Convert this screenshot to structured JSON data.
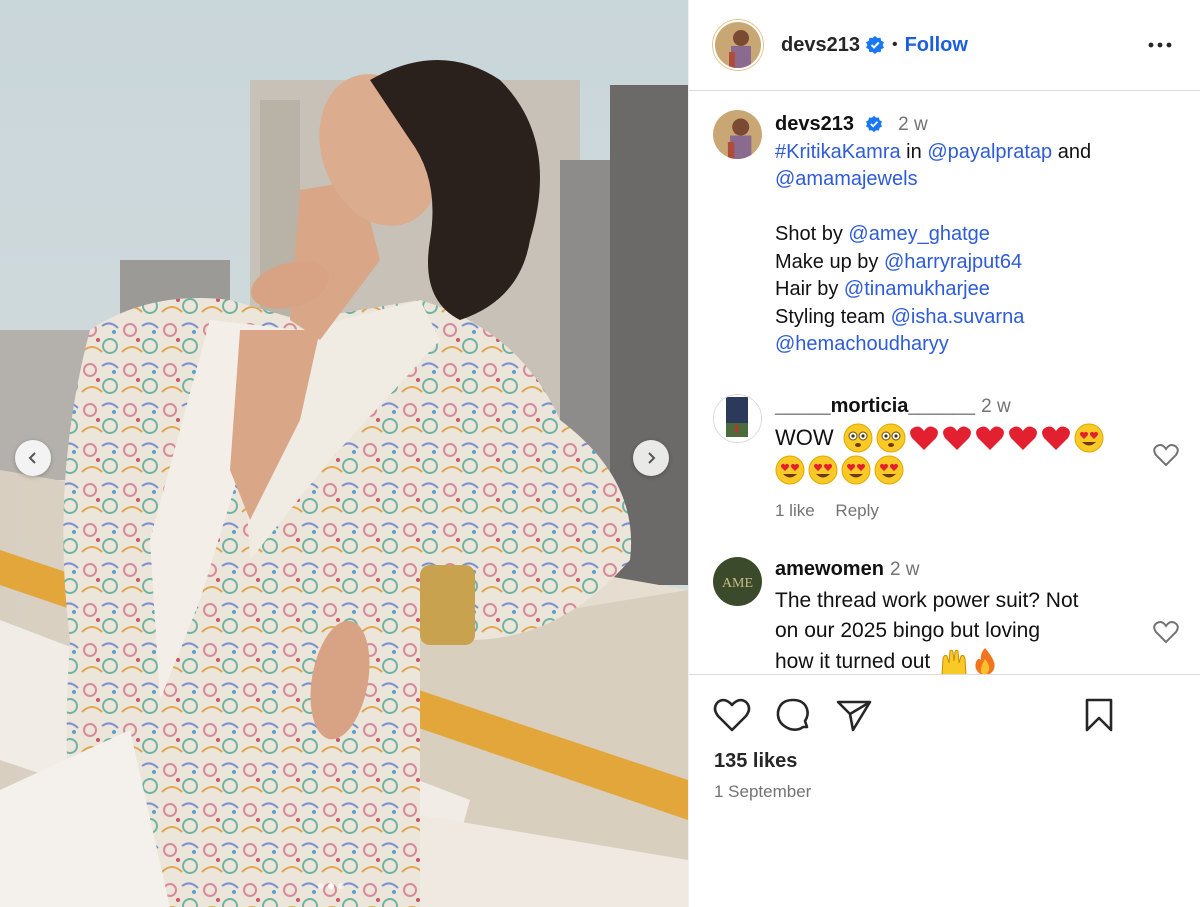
{
  "post": {
    "author": "devs213",
    "follow_label": "Follow",
    "separator": "•"
  },
  "caption": {
    "author": "devs213",
    "time": "2 w",
    "hashtag": "#KritikaKamra",
    "in_text": "in",
    "mention1": "@payalpratap",
    "and_text": "and",
    "mention2": "@amamajewels",
    "credits": [
      {
        "label": "Shot by",
        "handle": "@amey_ghatge"
      },
      {
        "label": "Make up by",
        "handle": "@harryrajput64"
      },
      {
        "label": "Hair by",
        "handle": "@tinamukharjee"
      },
      {
        "label": "Styling team",
        "handle": "@isha.suvarna"
      }
    ],
    "extra_handle": "@hemachoudharyy"
  },
  "comments": [
    {
      "author": "_____morticia______",
      "time": "2 w",
      "text": "WOW",
      "emojis_line1": [
        "flushed",
        "flushed",
        "red-heart",
        "red-heart",
        "red-heart",
        "red-heart",
        "red-heart",
        "heart-eyes"
      ],
      "emojis_line2": [
        "heart-eyes",
        "heart-eyes",
        "heart-eyes",
        "heart-eyes"
      ],
      "likes_label": "1 like",
      "reply_label": "Reply"
    },
    {
      "author": "amewomen",
      "time": "2 w",
      "text_line1": "The thread work power suit? Not",
      "text_line2": "on our 2025 bingo but loving",
      "text_line3": "how it turned out",
      "emojis": [
        "raising-hands",
        "fire"
      ]
    }
  ],
  "footer": {
    "likes": "135 likes",
    "date": "1 September"
  },
  "carousel": {
    "count": 3,
    "active_index": 1
  },
  "colors": {
    "link": "#2e5bd8",
    "follow": "#1a5fe0",
    "verified": "#1877f2",
    "muted": "#737373"
  },
  "icons": {
    "like": "heart-outline-icon",
    "comment": "speech-bubble-icon",
    "share": "paper-plane-icon",
    "save": "bookmark-icon",
    "more": "ellipsis-icon",
    "prev": "chevron-left-icon",
    "next": "chevron-right-icon"
  }
}
